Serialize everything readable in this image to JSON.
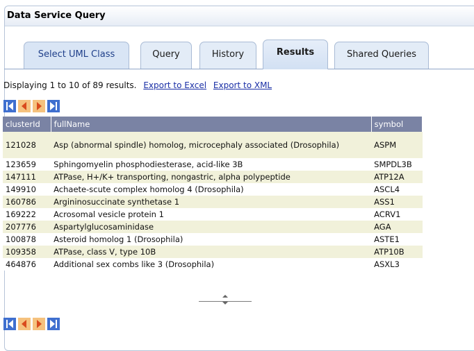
{
  "panel": {
    "title": "Data Service Query"
  },
  "tabs": [
    {
      "label": "Select UML Class",
      "active": false
    },
    {
      "label": "Query",
      "active": false
    },
    {
      "label": "History",
      "active": false
    },
    {
      "label": "Results",
      "active": true
    },
    {
      "label": "Shared Queries",
      "active": false
    }
  ],
  "results": {
    "summary": "Displaying 1 to 10 of 89 results.",
    "export_excel": "Export to Excel",
    "export_xml": "Export to XML",
    "columns": [
      "clusterId",
      "fullName",
      "symbol"
    ],
    "rows": [
      {
        "clusterId": "121028",
        "fullName": "Asp (abnormal spindle) homolog, microcephaly associated (Drosophila)",
        "symbol": "ASPM"
      },
      {
        "clusterId": "123659",
        "fullName": "Sphingomyelin phosphodiesterase, acid-like 3B",
        "symbol": "SMPDL3B"
      },
      {
        "clusterId": "147111",
        "fullName": "ATPase, H+/K+ transporting, nongastric, alpha polypeptide",
        "symbol": "ATP12A"
      },
      {
        "clusterId": "149910",
        "fullName": "Achaete-scute complex homolog 4 (Drosophila)",
        "symbol": "ASCL4"
      },
      {
        "clusterId": "160786",
        "fullName": "Argininosuccinate synthetase 1",
        "symbol": "ASS1"
      },
      {
        "clusterId": "169222",
        "fullName": "Acrosomal vesicle protein 1",
        "symbol": "ACRV1"
      },
      {
        "clusterId": "207776",
        "fullName": "Aspartylglucosaminidase",
        "symbol": "AGA"
      },
      {
        "clusterId": "100878",
        "fullName": "Asteroid homolog 1 (Drosophila)",
        "symbol": "ASTE1"
      },
      {
        "clusterId": "109358",
        "fullName": "ATPase, class V, type 10B",
        "symbol": "ATP10B"
      },
      {
        "clusterId": "464876",
        "fullName": "Additional sex combs like 3 (Drosophila)",
        "symbol": "ASXL3"
      }
    ]
  },
  "pager": {
    "buttons": [
      {
        "name": "first-page-icon",
        "color": "#3f6fcf"
      },
      {
        "name": "previous-page-icon",
        "color": "#f5c27e"
      },
      {
        "name": "next-page-icon",
        "color": "#f5c27e"
      },
      {
        "name": "last-page-icon",
        "color": "#3f6fcf"
      }
    ]
  },
  "colors": {
    "header_bg": "#7a83a4",
    "row_alt": "#f1f1da",
    "link": "#1a2fa6",
    "tab_border": "#a9bbd5"
  }
}
